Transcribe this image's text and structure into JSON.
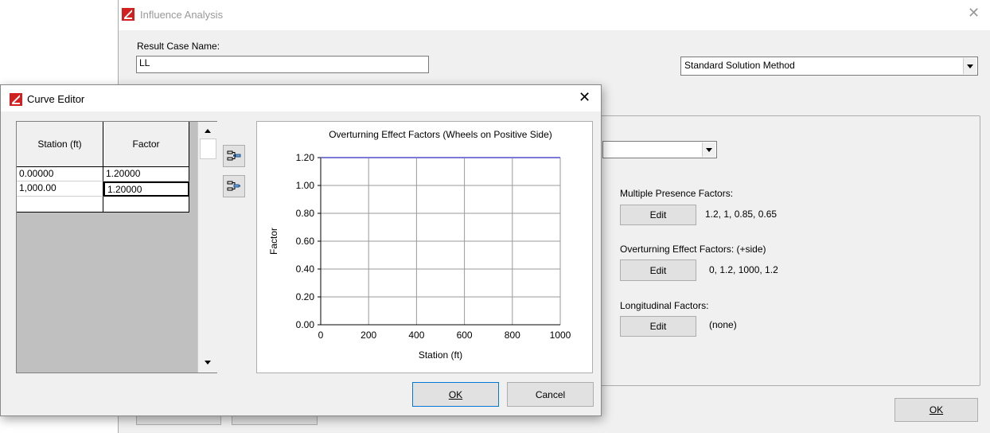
{
  "influence": {
    "title": "Influence Analysis",
    "result_case_label": "Result Case Name:",
    "result_case_value": "LL",
    "solution_method": "Standard Solution Method",
    "multiple_presence_label": "Multiple Presence Factors:",
    "multiple_presence_value": "1.2, 1, 0.85, 0.65",
    "overturning_label": "Overturning Effect Factors: (+side)",
    "overturning_value": "0, 1.2, 1000, 1.2",
    "longitudinal_label": "Longitudinal Factors:",
    "longitudinal_value": "(none)",
    "edit_label": "Edit",
    "ok_label": "OK"
  },
  "curve_editor": {
    "title": "Curve Editor",
    "columns": [
      "Station (ft)",
      "Factor"
    ],
    "rows": [
      [
        "0.00000",
        "1.20000"
      ],
      [
        "1,000.00",
        "1.20000"
      ]
    ],
    "ok_label": "OK",
    "cancel_label": "Cancel"
  },
  "chart_data": {
    "type": "line",
    "title": "Overturning Effect Factors (Wheels on Positive Side)",
    "xlabel": "Station (ft)",
    "ylabel": "Factor",
    "xlim": [
      0,
      1000
    ],
    "ylim": [
      0,
      1.2
    ],
    "xticks": [
      "0",
      "200",
      "400",
      "600",
      "800",
      "1000"
    ],
    "yticks": [
      "0.00",
      "0.20",
      "0.40",
      "0.60",
      "0.80",
      "1.00",
      "1.20"
    ],
    "grid": true,
    "series": [
      {
        "x": [
          0,
          1000
        ],
        "y": [
          1.2,
          1.2
        ],
        "color": "#7b7bd6"
      }
    ]
  }
}
